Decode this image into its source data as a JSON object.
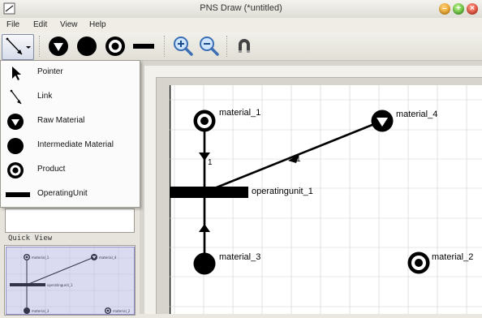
{
  "window": {
    "title": "PNS Draw (*untitled)"
  },
  "menubar": {
    "items": [
      "File",
      "Edit",
      "View",
      "Help"
    ]
  },
  "toolbar": {
    "tools": [
      {
        "name": "link-tool-dropdown",
        "icon": "link-arrow-icon"
      },
      {
        "name": "raw-material-tool",
        "icon": "raw-material-icon"
      },
      {
        "name": "intermediate-material-tool",
        "icon": "intermediate-material-icon"
      },
      {
        "name": "product-tool",
        "icon": "product-icon"
      },
      {
        "name": "operating-unit-tool",
        "icon": "operating-unit-icon"
      },
      {
        "name": "zoom-in",
        "icon": "zoom-in-icon"
      },
      {
        "name": "zoom-out",
        "icon": "zoom-out-icon"
      },
      {
        "name": "magnet",
        "icon": "magnet-icon"
      }
    ]
  },
  "tool_menu": {
    "items": [
      {
        "label": "Pointer",
        "icon": "pointer-icon"
      },
      {
        "label": "Link",
        "icon": "link-icon"
      },
      {
        "label": "Raw Material",
        "icon": "raw-material-icon"
      },
      {
        "label": "Intermediate Material",
        "icon": "intermediate-material-icon"
      },
      {
        "label": "Product",
        "icon": "product-icon"
      },
      {
        "label": "OperatingUnit",
        "icon": "operating-unit-icon"
      }
    ]
  },
  "quick_view": {
    "label": "Quick View",
    "labels": [
      "material_1",
      "material_4",
      "operatingunit_1",
      "material_3",
      "material_2"
    ]
  },
  "diagram": {
    "nodes": [
      {
        "id": "material_1",
        "type": "product",
        "label": "material_1"
      },
      {
        "id": "material_4",
        "type": "raw",
        "label": "material_4"
      },
      {
        "id": "operatingunit_1",
        "type": "operating-unit",
        "label": "operatingunit_1"
      },
      {
        "id": "material_3",
        "type": "intermediate",
        "label": "material_3"
      },
      {
        "id": "material_2",
        "type": "product",
        "label": "material_2"
      }
    ],
    "edge_labels": [
      "1",
      "1"
    ]
  },
  "colors": {
    "accent": "#000000",
    "quick_view_overlay": "#9696d7"
  }
}
